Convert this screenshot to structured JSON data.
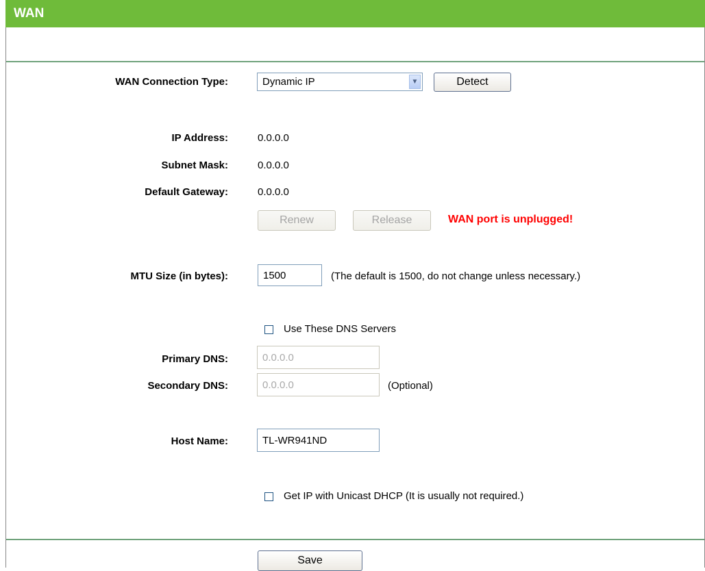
{
  "header": {
    "title": "WAN"
  },
  "connection": {
    "label": "WAN Connection Type:",
    "selected": "Dynamic IP",
    "detect_label": "Detect"
  },
  "status": {
    "ip_label": "IP Address:",
    "ip_value": "0.0.0.0",
    "mask_label": "Subnet Mask:",
    "mask_value": "0.0.0.0",
    "gateway_label": "Default Gateway:",
    "gateway_value": "0.0.0.0",
    "renew_label": "Renew",
    "release_label": "Release",
    "warning": "WAN port is unplugged!"
  },
  "mtu": {
    "label": "MTU Size (in bytes):",
    "value": "1500",
    "note": "(The default is 1500, do not change unless necessary.)"
  },
  "dns": {
    "use_label": "Use These DNS Servers",
    "use_checked": false,
    "primary_label": "Primary DNS:",
    "primary_value": "0.0.0.0",
    "secondary_label": "Secondary DNS:",
    "secondary_value": "0.0.0.0",
    "optional_note": "(Optional)"
  },
  "host": {
    "label": "Host Name:",
    "value": "TL-WR941ND"
  },
  "unicast": {
    "label": "Get IP with Unicast DHCP (It is usually not required.)",
    "checked": false
  },
  "footer": {
    "save_label": "Save"
  },
  "colors": {
    "title_bar": "#6fbb3a",
    "divider": "#6fa27b",
    "warning": "#ff0000"
  }
}
